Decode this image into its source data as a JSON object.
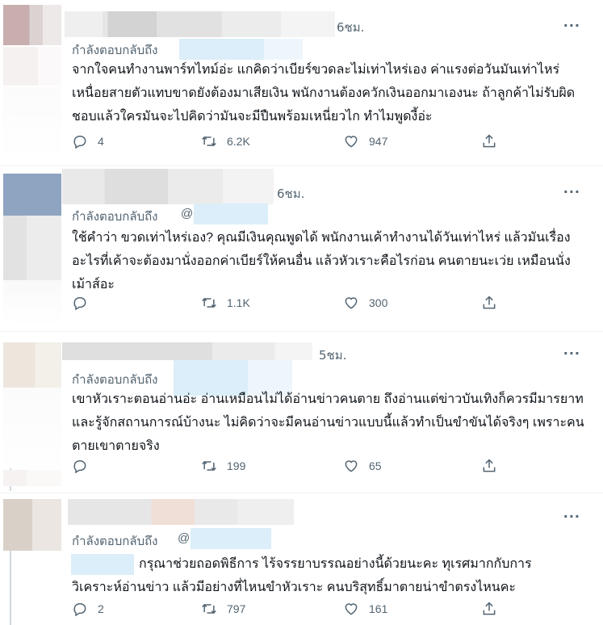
{
  "tweets": [
    {
      "time": "6ชม.",
      "reply_label": "กำลังตอบกลับถึง",
      "reply_at": "",
      "text": "จากใจคนทำงานพาร์ทไทม์อ่ะ แกคิดว่าเบียร์ขวดละไม่เท่าไหร่เอง ค่าแรงต่อวันมันเท่าไหร่เหนื่อยสายตัวแทบขาดยังต้องมาเสียเงิน พนักงานต้องควักเงินออกมาเองนะ ถ้าลูกค้าไม่รับผิดชอบแล้วใครมันจะไปคิดว่ามันจะมีปืนพร้อมเหนี่ยวไก ทำไมพูดงี้อ่ะ",
      "replies": "4",
      "retweets": "6.2K",
      "likes": "947"
    },
    {
      "time": "6ชม.",
      "reply_label": "กำลังตอบกลับถึง",
      "reply_at": "@",
      "text": "ใช้คำว่า ขวดเท่าไหร่เอง? คุณมีเงินคุณพูดได้ พนักงานเค้าทำงานได้วันเท่าไหร่ แล้วมันเรื่องอะไรที่เค้าจะต้องมานั่งออกค่าเบียร์ให้คนอื่น แล้วหัวเราะคือไรก่อน คนตายนะเว่ย เหมือนนั่งเม้าส์อะ",
      "replies": "",
      "retweets": "1.1K",
      "likes": "300"
    },
    {
      "time": "5ชม.",
      "reply_label": "กำลังตอบกลับถึง",
      "reply_at": "",
      "text": "เขาหัวเราะตอนอ่านอ่ะ อ่านเหมือนไม่ได้อ่านข่าวคนตาย ถึงอ่านแต่ข่าวบันเทิงก็ควรมีมารยาทและรู้จักสถานการณ์บ้างนะ ไม่คิดว่าจะมีคนอ่านข่าวแบบนี้แล้วทำเป็นขำขันได้จริงๆ เพราะคนตายเขาตายจริง",
      "replies": "",
      "retweets": "199",
      "likes": "65"
    },
    {
      "time": "",
      "reply_label": "กำลังตอบกลับถึง",
      "reply_at": "@",
      "text_line1": "กรุณาช่วยถอดพิธีการ ไร้จรรยาบรรณอย่างนี้ด้วยนะคะ  ทุเรศมากกับการ",
      "text_line2": "วิเคราะห์อ่านข่าว   แล้วมีอย่างที่ไหนขำหัวเราะ  คนบริสุทธิ์มาตายน่าขำตรงไหนคะ",
      "replies": "2",
      "retweets": "797",
      "likes": "161"
    }
  ],
  "icons": {
    "reply": "comment-bubble-icon",
    "retweet": "retweet-icon",
    "like": "heart-icon",
    "share": "share-upload-icon",
    "more": "more-dots-icon"
  },
  "more_label": "···"
}
